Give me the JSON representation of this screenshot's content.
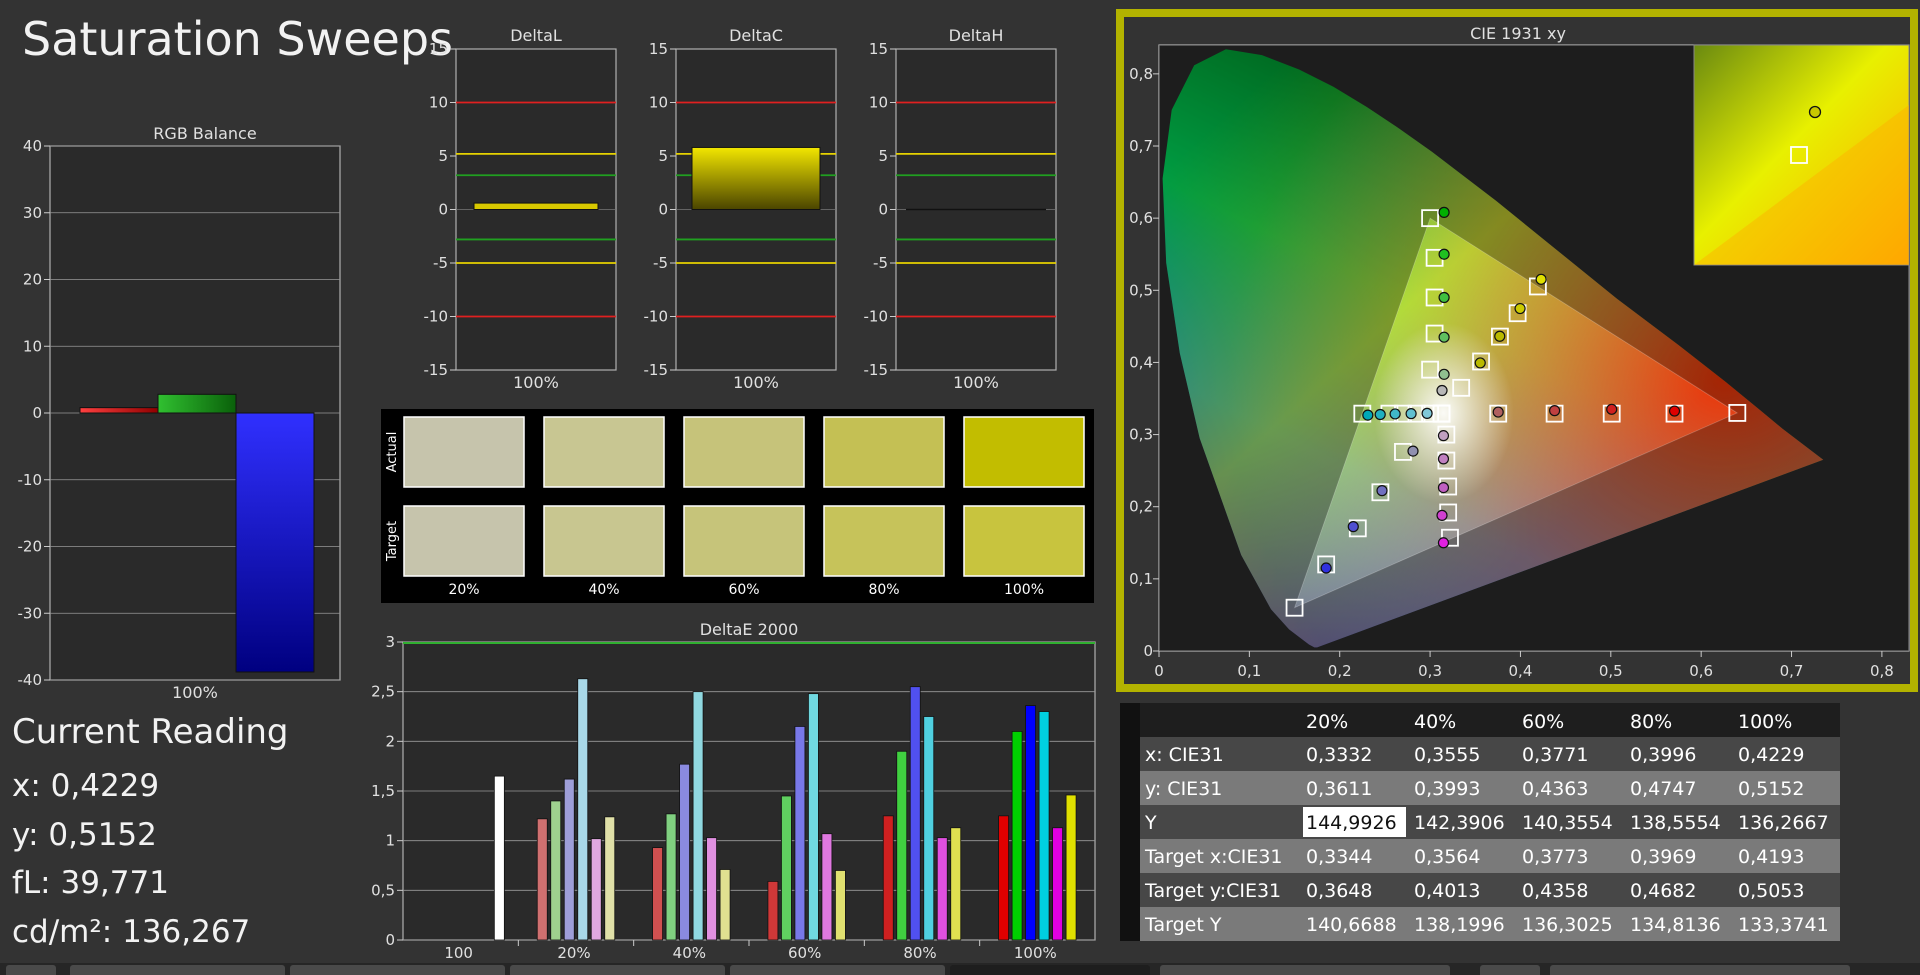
{
  "page": {
    "title": "Saturation Sweeps",
    "reading": {
      "heading": "Current Reading",
      "x": "x: 0,4229",
      "y": "y: 0,5152",
      "fl": "fL: 39,771",
      "cdm2": "cd/m²: 136,267"
    }
  },
  "colors": {
    "background": "#333333",
    "panel": "#2a2a2a",
    "grid": "#999999",
    "highlight_border": "#b3b300",
    "red_limit": "#e02020",
    "yellow_limit": "#e6d200",
    "green_limit": "#20a020"
  },
  "chart_data": [
    {
      "id": "rgb_balance",
      "type": "bar",
      "title": "RGB Balance",
      "categories": [
        "100%"
      ],
      "ylim": [
        -40,
        40
      ],
      "yticks": [
        "40",
        "30",
        "20",
        "10",
        "0",
        "-10",
        "-20",
        "-30",
        "-40"
      ],
      "series": [
        {
          "color": "#e02020",
          "values": [
            0.8
          ]
        },
        {
          "color": "#1a9a1a",
          "values": [
            2.8
          ]
        },
        {
          "color": "#1a1aff",
          "values": [
            -38.8
          ]
        }
      ]
    },
    {
      "id": "delta_l",
      "type": "bar",
      "title": "DeltaL",
      "categories": [
        "100%"
      ],
      "values": [
        0.6
      ],
      "ylim": [
        -15,
        15
      ],
      "yticks": [
        "15",
        "10",
        "5",
        "0",
        "-5",
        "-10",
        "-15"
      ]
    },
    {
      "id": "delta_c",
      "type": "bar",
      "title": "DeltaC",
      "categories": [
        "100%"
      ],
      "values": [
        5.8
      ],
      "ylim": [
        -15,
        15
      ],
      "yticks": [
        "15",
        "10",
        "5",
        "0",
        "-5",
        "-10",
        "-15"
      ]
    },
    {
      "id": "delta_h",
      "type": "bar",
      "title": "DeltaH",
      "categories": [
        "100%"
      ],
      "values": [
        0.0
      ],
      "ylim": [
        -15,
        15
      ],
      "yticks": [
        "15",
        "10",
        "5",
        "0",
        "-5",
        "-10",
        "-15"
      ]
    },
    {
      "id": "swatches",
      "type": "table",
      "row_labels": [
        "Actual",
        "Target"
      ],
      "categories": [
        "20%",
        "40%",
        "60%",
        "80%",
        "100%"
      ],
      "actual_colors": [
        "#c6c4ac",
        "#c8c692",
        "#c6c37a",
        "#c4c054",
        "#c2bd00"
      ],
      "target_colors": [
        "#c6c4ac",
        "#c8c690",
        "#c6c47a",
        "#c6c35a",
        "#c8c43e"
      ]
    },
    {
      "id": "delta_e",
      "type": "bar",
      "title": "DeltaE 2000",
      "categories": [
        "100",
        "20%",
        "40%",
        "60%",
        "80%",
        "100%"
      ],
      "ylim": [
        0,
        3
      ],
      "yticks": [
        "3",
        "2,5",
        "2",
        "1,5",
        "1",
        "0,5",
        "0"
      ],
      "groups": [
        {
          "colors": [
            "#ffffff"
          ],
          "values": [
            1.65
          ]
        },
        {
          "colors": [
            "#d07070",
            "#9ed08e",
            "#9e9ed8",
            "#a8d8e8",
            "#e0a8e0",
            "#e0e0a8"
          ],
          "values": [
            1.22,
            1.4,
            1.62,
            2.63,
            1.02,
            1.24
          ]
        },
        {
          "colors": [
            "#d05050",
            "#80d080",
            "#8a8ae0",
            "#90d8e0",
            "#e090e0",
            "#e0e090"
          ],
          "values": [
            0.93,
            1.27,
            1.77,
            2.5,
            1.03,
            0.71
          ]
        },
        {
          "colors": [
            "#d03838",
            "#60d060",
            "#7878e8",
            "#70d8e0",
            "#e078e0",
            "#e0e070"
          ],
          "values": [
            0.59,
            1.45,
            2.15,
            2.48,
            1.07,
            0.7
          ]
        },
        {
          "colors": [
            "#d02020",
            "#40d040",
            "#5050f0",
            "#50d0e0",
            "#e050e0",
            "#e0e050"
          ],
          "values": [
            1.25,
            1.9,
            2.55,
            2.25,
            1.03,
            1.13
          ]
        },
        {
          "colors": [
            "#e00000",
            "#00d000",
            "#0000ff",
            "#00d0e0",
            "#e000e0",
            "#e0e000"
          ],
          "values": [
            1.25,
            2.1,
            2.36,
            2.3,
            1.13,
            1.46
          ]
        }
      ]
    },
    {
      "id": "cie",
      "type": "scatter",
      "title": "CIE 1931 xy",
      "xlim": [
        0,
        0.83
      ],
      "ylim": [
        0,
        0.84
      ],
      "xticks": [
        "0",
        "0,1",
        "0,2",
        "0,3",
        "0,4",
        "0,5",
        "0,6",
        "0,7",
        "0,8"
      ],
      "yticks": [
        "0",
        "0,1",
        "0,2",
        "0,3",
        "0,4",
        "0,5",
        "0,6",
        "0,7",
        "0,8"
      ],
      "gamut": [
        [
          0.64,
          0.33
        ],
        [
          0.3,
          0.6
        ],
        [
          0.15,
          0.06
        ]
      ],
      "targets": [
        [
          0.3127,
          0.329
        ],
        [
          0.3344,
          0.3648
        ],
        [
          0.3564,
          0.4013
        ],
        [
          0.3773,
          0.4358
        ],
        [
          0.3969,
          0.4682
        ],
        [
          0.4193,
          0.5053
        ],
        [
          0.3127,
          0.329
        ],
        [
          0.3754,
          0.329
        ],
        [
          0.4378,
          0.329
        ],
        [
          0.501,
          0.329
        ],
        [
          0.5705,
          0.329
        ],
        [
          0.64,
          0.33
        ],
        [
          0.3127,
          0.329
        ],
        [
          0.3,
          0.39
        ],
        [
          0.305,
          0.44
        ],
        [
          0.305,
          0.49
        ],
        [
          0.305,
          0.545
        ],
        [
          0.3,
          0.6
        ],
        [
          0.3127,
          0.329
        ],
        [
          0.3,
          0.329
        ],
        [
          0.285,
          0.329
        ],
        [
          0.27,
          0.329
        ],
        [
          0.255,
          0.329
        ],
        [
          0.225,
          0.329
        ],
        [
          0.3127,
          0.329
        ],
        [
          0.27,
          0.276
        ],
        [
          0.245,
          0.22
        ],
        [
          0.22,
          0.17
        ],
        [
          0.185,
          0.12
        ],
        [
          0.15,
          0.06
        ],
        [
          0.3127,
          0.329
        ],
        [
          0.318,
          0.3
        ],
        [
          0.318,
          0.264
        ],
        [
          0.32,
          0.228
        ],
        [
          0.32,
          0.192
        ],
        [
          0.322,
          0.157
        ]
      ],
      "measured": [
        {
          "x": 0.3132,
          "y": 0.3611,
          "color": "#b7b7b7"
        },
        {
          "x": 0.3555,
          "y": 0.3993,
          "color": "#b9b900"
        },
        {
          "x": 0.3771,
          "y": 0.4363,
          "color": "#b9b900"
        },
        {
          "x": 0.3996,
          "y": 0.4747,
          "color": "#cbcb00"
        },
        {
          "x": 0.4229,
          "y": 0.5152,
          "color": "#e0e000"
        },
        {
          "x": 0.3754,
          "y": 0.3312,
          "color": "#b06060"
        },
        {
          "x": 0.4378,
          "y": 0.3332,
          "color": "#c04040"
        },
        {
          "x": 0.501,
          "y": 0.335,
          "color": "#d02020"
        },
        {
          "x": 0.5705,
          "y": 0.3326,
          "color": "#e00000"
        },
        {
          "x": 0.3155,
          "y": 0.3835,
          "color": "#90c090"
        },
        {
          "x": 0.3155,
          "y": 0.435,
          "color": "#60c060"
        },
        {
          "x": 0.3155,
          "y": 0.49,
          "color": "#40c040"
        },
        {
          "x": 0.3155,
          "y": 0.55,
          "color": "#20c020"
        },
        {
          "x": 0.3155,
          "y": 0.608,
          "color": "#00b000"
        },
        {
          "x": 0.2967,
          "y": 0.3294,
          "color": "#80c8d8"
        },
        {
          "x": 0.279,
          "y": 0.329,
          "color": "#60c0d0"
        },
        {
          "x": 0.2613,
          "y": 0.3286,
          "color": "#40b8c8"
        },
        {
          "x": 0.2448,
          "y": 0.3278,
          "color": "#20b0c0"
        },
        {
          "x": 0.2311,
          "y": 0.327,
          "color": "#00a8b8"
        },
        {
          "x": 0.2811,
          "y": 0.2771,
          "color": "#9090b0"
        },
        {
          "x": 0.2468,
          "y": 0.2223,
          "color": "#7070c0"
        },
        {
          "x": 0.215,
          "y": 0.1724,
          "color": "#5050d0"
        },
        {
          "x": 0.185,
          "y": 0.115,
          "color": "#3030e0"
        },
        {
          "x": 0.3148,
          "y": 0.2985,
          "color": "#c0a0c0"
        },
        {
          "x": 0.3148,
          "y": 0.2663,
          "color": "#c080c0"
        },
        {
          "x": 0.3148,
          "y": 0.2265,
          "color": "#c060c0"
        },
        {
          "x": 0.3132,
          "y": 0.188,
          "color": "#d040d0"
        },
        {
          "x": 0.3148,
          "y": 0.15,
          "color": "#e020e0"
        }
      ],
      "inset_points": {
        "target": "0,4193 / 0,5053",
        "measured": "0,4229 / 0,5152"
      }
    },
    {
      "id": "values_table",
      "type": "table",
      "columns": [
        "20%",
        "40%",
        "60%",
        "80%",
        "100%"
      ],
      "rows": [
        {
          "label": "x: CIE31",
          "values": [
            "0,3332",
            "0,3555",
            "0,3771",
            "0,3996",
            "0,4229"
          ]
        },
        {
          "label": "y: CIE31",
          "values": [
            "0,3611",
            "0,3993",
            "0,4363",
            "0,4747",
            "0,5152"
          ]
        },
        {
          "label": "Y",
          "values": [
            "144,9926",
            "142,3906",
            "140,3554",
            "138,5554",
            "136,2667"
          ]
        },
        {
          "label": "Target x:CIE31",
          "values": [
            "0,3344",
            "0,3564",
            "0,3773",
            "0,3969",
            "0,4193"
          ]
        },
        {
          "label": "Target y:CIE31",
          "values": [
            "0,3648",
            "0,4013",
            "0,4358",
            "0,4682",
            "0,5053"
          ]
        },
        {
          "label": "Target Y",
          "values": [
            "140,6688",
            "138,1996",
            "136,3025",
            "134,8136",
            "133,3741"
          ]
        }
      ]
    }
  ]
}
